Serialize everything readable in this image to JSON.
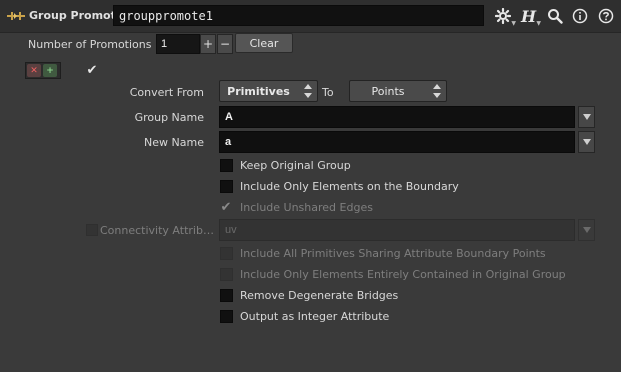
{
  "header": {
    "node_type": "Group Promote",
    "node_name": "grouppromote1",
    "icons": [
      "gear-icon",
      "houdini-h-icon",
      "search-icon",
      "info-icon",
      "help-icon"
    ]
  },
  "params": {
    "num_promotions_label": "Number of Promotions",
    "num_promotions_value": "1",
    "plus_label": "+",
    "minus_label": "−",
    "clear_label": "Clear",
    "convert_from_label": "Convert From",
    "convert_from_value": "Primitives",
    "to_label": "To",
    "to_value": "Points",
    "group_name_label": "Group Name",
    "group_name_value": "A",
    "new_name_label": "New Name",
    "new_name_value": "a",
    "connectivity_label": "Connectivity Attrib…",
    "connectivity_value": "uv",
    "checkboxes": {
      "keep_original": {
        "label": "Keep Original Group",
        "checked": false,
        "enabled": true
      },
      "boundary_only": {
        "label": "Include Only Elements on the Boundary",
        "checked": false,
        "enabled": true
      },
      "unshared_edges": {
        "label": "Include Unshared Edges",
        "checked": true,
        "enabled": false
      },
      "all_prims_sharing": {
        "label": "Include All Primitives Sharing Attribute Boundary Points",
        "checked": false,
        "enabled": false
      },
      "entirely_contained": {
        "label": "Include Only Elements Entirely Contained in Original Group",
        "checked": false,
        "enabled": false
      },
      "remove_degenerate": {
        "label": "Remove Degenerate Bridges",
        "checked": false,
        "enabled": true
      },
      "output_integer": {
        "label": "Output as Integer Attribute",
        "checked": false,
        "enabled": true
      }
    }
  },
  "colors": {
    "background": "#3a3a3a",
    "header": "#2f2f2f",
    "field": "#101010",
    "text": "#d8d8d8",
    "disabled_text": "#7e7e7e"
  }
}
